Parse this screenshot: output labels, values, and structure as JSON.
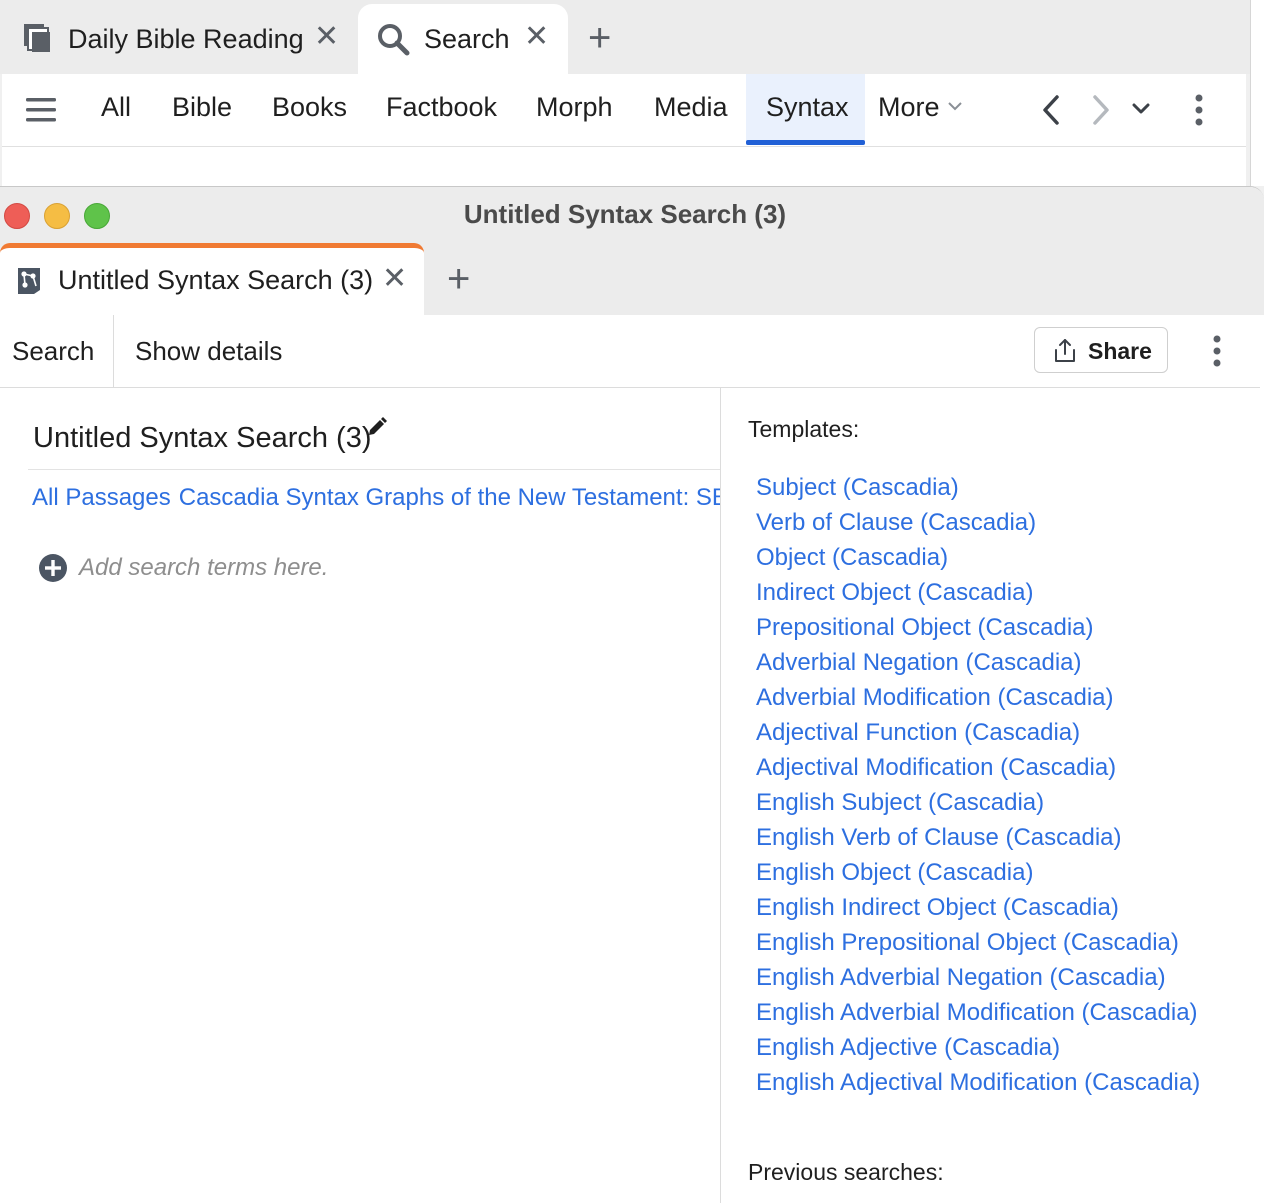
{
  "app_tabs": [
    {
      "label": "Daily Bible Reading",
      "icon": "books-stack-icon"
    },
    {
      "label": "Search",
      "icon": "search-icon"
    }
  ],
  "nav": {
    "items": [
      "All",
      "Bible",
      "Books",
      "Factbook",
      "Morph",
      "Media",
      "Syntax"
    ],
    "more_label": "More",
    "active": "Syntax"
  },
  "window": {
    "title": "Untitled Syntax Search (3)",
    "tab_label": "Untitled Syntax Search (3)"
  },
  "toolbar": {
    "search_label": "Search",
    "details_label": "Show details",
    "share_label": "Share"
  },
  "editor": {
    "title": "Untitled Syntax Search (3)",
    "range": "All Passages",
    "resource": "Cascadia Syntax Graphs of the New Testament: SBL E",
    "add_hint": "Add search terms here."
  },
  "templates": {
    "heading": "Templates:",
    "items": [
      "Subject (Cascadia)",
      "Verb of Clause (Cascadia)",
      "Object (Cascadia)",
      "Indirect Object (Cascadia)",
      "Prepositional Object (Cascadia)",
      "Adverbial Negation (Cascadia)",
      "Adverbial Modification (Cascadia)",
      "Adjectival Function (Cascadia)",
      "Adjectival Modification (Cascadia)",
      "English Subject (Cascadia)",
      "English Verb of Clause (Cascadia)",
      "English Object (Cascadia)",
      "English Indirect Object (Cascadia)",
      "English Prepositional Object (Cascadia)",
      "English Adverbial Negation (Cascadia)",
      "English Adverbial Modification (Cascadia)",
      "English Adjective (Cascadia)",
      "English Adjectival Modification (Cascadia)"
    ]
  },
  "previous": {
    "heading": "Previous searches:"
  },
  "colors": {
    "link": "#2d6fe0",
    "active_tab_accent": "#f07a33",
    "nav_underline": "#2160d6",
    "close_light": "#ee5e57",
    "minimize_light": "#f5bd44",
    "zoom_light": "#5fc34a"
  }
}
